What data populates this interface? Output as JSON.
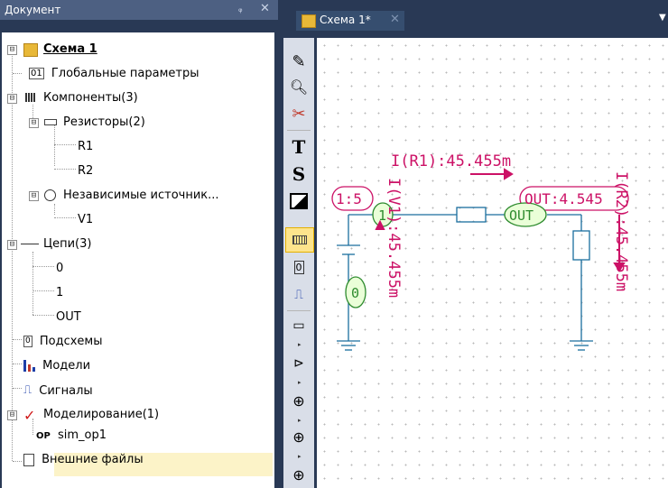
{
  "panel": {
    "title": "Документ",
    "pin_glyph": "ᵩ",
    "close_glyph": "✕"
  },
  "tree": {
    "root": {
      "label": "Схема 1",
      "expander": "⊟"
    },
    "global_params": "Глобальные параметры",
    "components": {
      "label": "Компоненты(3)",
      "expander": "⊟"
    },
    "resistors": {
      "label": "Резисторы(2)",
      "expander": "⊟",
      "items": [
        "R1",
        "R2"
      ]
    },
    "sources": {
      "label": "Независимые источник...",
      "expander": "⊟",
      "items": [
        "V1"
      ]
    },
    "nets": {
      "label": "Цепи(3)",
      "expander": "⊟",
      "items": [
        "0",
        "1",
        "OUT"
      ]
    },
    "subcircuits": "Подсхемы",
    "models": "Модели",
    "signals": "Сигналы",
    "simulation": {
      "label": "Моделирование(1)",
      "expander": "⊟",
      "items": [
        {
          "tag": "OP",
          "label": "sim_op1"
        }
      ]
    },
    "external_files": "Внешние файлы"
  },
  "editor": {
    "tab": {
      "label": "Схема 1*",
      "close": "✕"
    },
    "toolbar": [
      "pencil-tool",
      "zoom-tool",
      "cut-tool",
      "text-tool",
      "symbol-tool",
      "image-tool",
      "component-tool",
      "chip-tool",
      "signal-tool",
      "resistor-tool",
      "diode-tool",
      "source-tool",
      "current-source-tool",
      "ground-source-tool"
    ],
    "colors": {
      "wire": "#1a6e9e",
      "net_label": "#cc1166",
      "node_label": "#2e8b2e"
    }
  },
  "schematic": {
    "probe_r1": "I(R1):45.455m",
    "probe_v1": "I(V1):45.455m",
    "probe_r2": "I(R2):45.455m",
    "net_label_left": "1:5",
    "net_label_right": "OUT:4.545",
    "node_1": "1",
    "node_out": "OUT",
    "node_0": "0"
  }
}
